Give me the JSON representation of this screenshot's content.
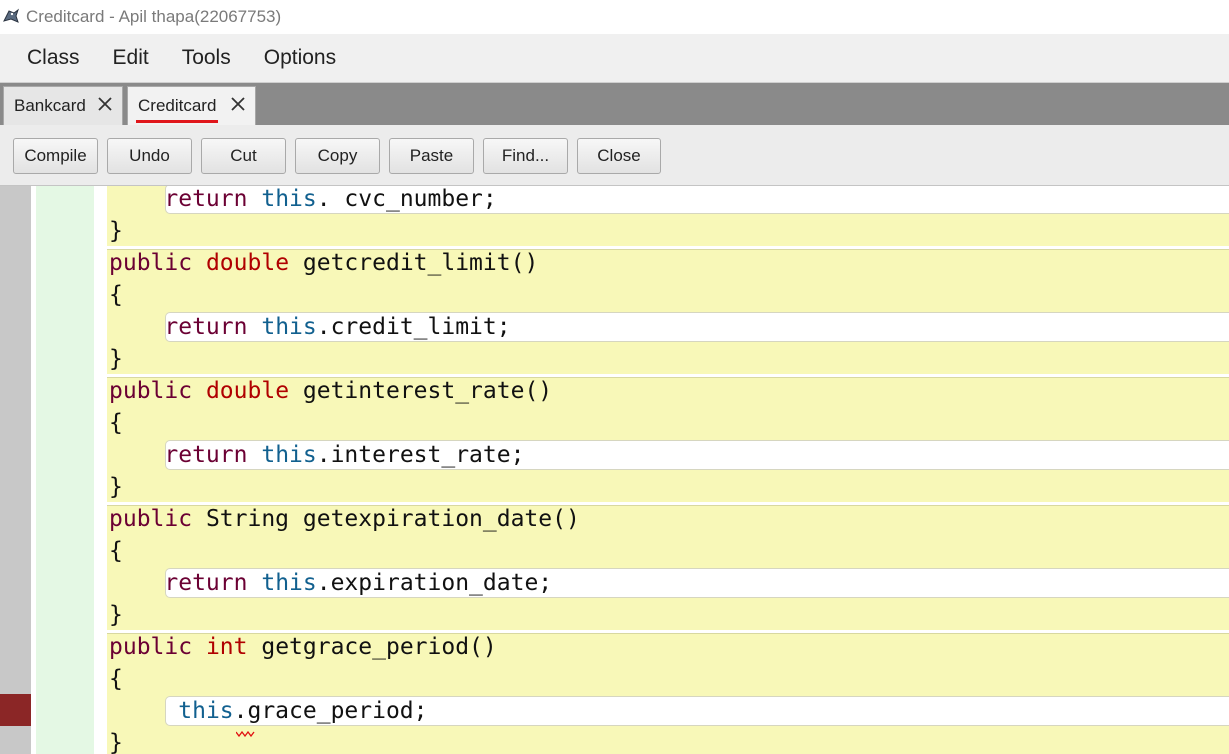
{
  "window": {
    "title": "Creditcard - Apil thapa(22067753)"
  },
  "menu": {
    "items": [
      "Class",
      "Edit",
      "Tools",
      "Options"
    ]
  },
  "tabs": [
    {
      "label": "Bankcard",
      "active": false
    },
    {
      "label": "Creditcard",
      "active": true
    }
  ],
  "toolbar": {
    "buttons": [
      "Compile",
      "Undo",
      "Cut",
      "Copy",
      "Paste",
      "Find...",
      "Close"
    ]
  },
  "colors": {
    "keyword": "#6b0033",
    "type": "#b00000",
    "this_keyword": "#11608f",
    "scope_method": "#f8f8b8",
    "scope_class": "#e4f8e4",
    "breakpoint": "#8b2626",
    "active_tab_underline": "#e0161b"
  },
  "editor": {
    "lines": [
      {
        "indent": "    ",
        "tokens": [
          [
            "kw",
            "return"
          ],
          [
            "",
            " "
          ],
          [
            "th",
            "this"
          ],
          [
            "",
            ". cvc_number;"
          ]
        ]
      },
      {
        "indent": "",
        "tokens": [
          [
            "",
            "}"
          ]
        ]
      },
      {
        "indent": "",
        "tokens": [
          [
            "kw",
            "public"
          ],
          [
            "",
            " "
          ],
          [
            "ty",
            "double"
          ],
          [
            "",
            " getcredit_limit()"
          ]
        ]
      },
      {
        "indent": "",
        "tokens": [
          [
            "",
            "{"
          ]
        ]
      },
      {
        "indent": "    ",
        "tokens": [
          [
            "kw",
            "return"
          ],
          [
            "",
            " "
          ],
          [
            "th",
            "this"
          ],
          [
            "",
            ".credit_limit;"
          ]
        ]
      },
      {
        "indent": "",
        "tokens": [
          [
            "",
            "}"
          ]
        ]
      },
      {
        "indent": "",
        "tokens": [
          [
            "kw",
            "public"
          ],
          [
            "",
            " "
          ],
          [
            "ty",
            "double"
          ],
          [
            "",
            " getinterest_rate()"
          ]
        ]
      },
      {
        "indent": "",
        "tokens": [
          [
            "",
            "{"
          ]
        ]
      },
      {
        "indent": "    ",
        "tokens": [
          [
            "kw",
            "return"
          ],
          [
            "",
            " "
          ],
          [
            "th",
            "this"
          ],
          [
            "",
            ".interest_rate;"
          ]
        ]
      },
      {
        "indent": "",
        "tokens": [
          [
            "",
            "}"
          ]
        ]
      },
      {
        "indent": "",
        "tokens": [
          [
            "kw",
            "public"
          ],
          [
            "",
            " String getexpiration_date()"
          ]
        ]
      },
      {
        "indent": "",
        "tokens": [
          [
            "",
            "{"
          ]
        ]
      },
      {
        "indent": "    ",
        "tokens": [
          [
            "kw",
            "return"
          ],
          [
            "",
            " "
          ],
          [
            "th",
            "this"
          ],
          [
            "",
            ".expiration_date;"
          ]
        ]
      },
      {
        "indent": "",
        "tokens": [
          [
            "",
            "}"
          ]
        ]
      },
      {
        "indent": "",
        "tokens": [
          [
            "kw",
            "public"
          ],
          [
            "",
            " "
          ],
          [
            "ty",
            "int"
          ],
          [
            "",
            " getgrace_period()"
          ]
        ]
      },
      {
        "indent": "",
        "tokens": [
          [
            "",
            "{"
          ]
        ]
      },
      {
        "indent": "     ",
        "tokens": [
          [
            "th",
            "this"
          ],
          [
            "",
            ".grace_period;"
          ]
        ],
        "error": true
      },
      {
        "indent": "",
        "tokens": [
          [
            "",
            "}"
          ]
        ]
      }
    ]
  }
}
